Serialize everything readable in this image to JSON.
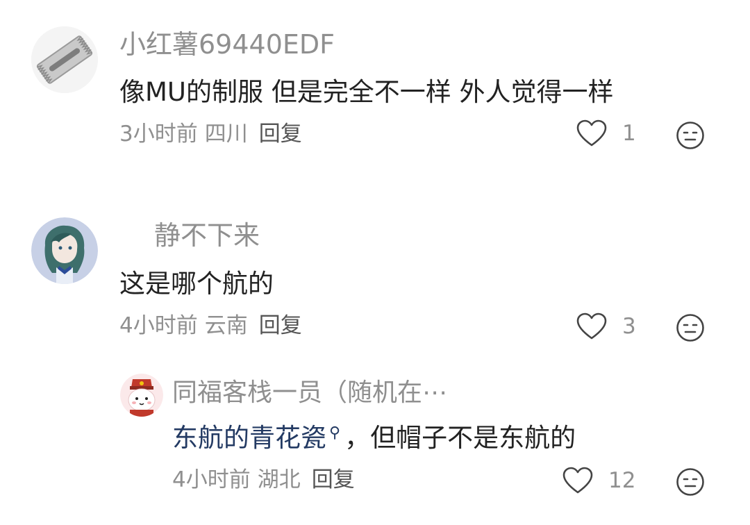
{
  "comments": [
    {
      "username": "小红薯69440EDF",
      "text": "像MU的制服 但是完全不一样 外人觉得一样",
      "time": "3小时前",
      "location": "四川",
      "reply_label": "回复",
      "likes": "1",
      "avatar": "razor-blade"
    },
    {
      "username": "静不下来",
      "text": "这是哪个航的",
      "time": "4小时前",
      "location": "云南",
      "reply_label": "回复",
      "likes": "3",
      "avatar": "anime-character"
    }
  ],
  "reply": {
    "username": "同福客栈一员（随机在⋯",
    "link_text": "东航的青花瓷",
    "text_after": "，但帽子不是东航的",
    "time": "4小时前",
    "location": "湖北",
    "reply_label": "回复",
    "likes": "12",
    "avatar": "cartoon-mascot"
  },
  "icons": {
    "like": "heart-outline-icon",
    "dislike": "neutral-face-icon",
    "search": "search-icon"
  },
  "colors": {
    "secondary_text": "#8f8f8f",
    "link": "#233a63",
    "primary_text": "#222222"
  }
}
